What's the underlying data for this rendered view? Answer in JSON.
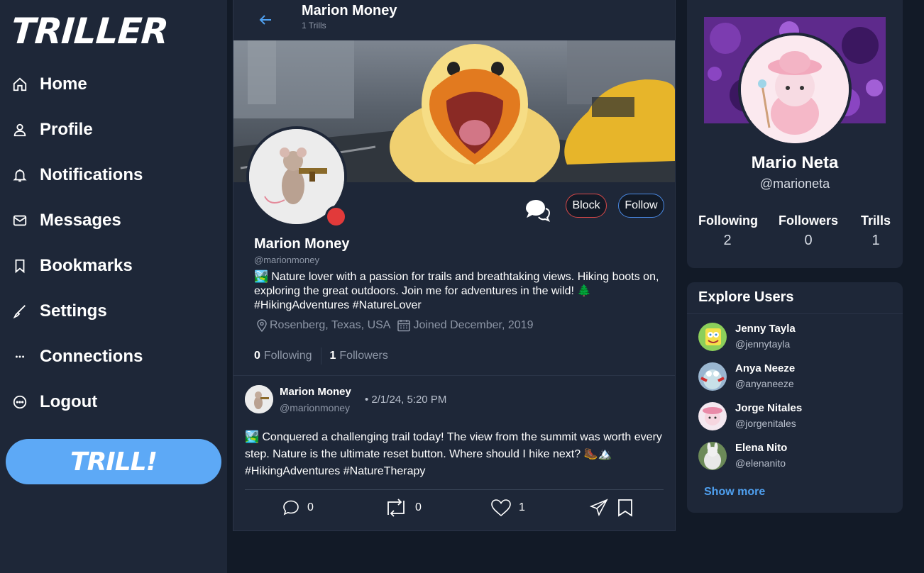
{
  "app": {
    "logo": "TRILLER",
    "compose_label": "TRILL!"
  },
  "sidebar": {
    "items": [
      {
        "label": "Home",
        "icon": "home-icon"
      },
      {
        "label": "Profile",
        "icon": "user-icon"
      },
      {
        "label": "Notifications",
        "icon": "bell-icon"
      },
      {
        "label": "Messages",
        "icon": "mail-icon"
      },
      {
        "label": "Bookmarks",
        "icon": "bookmark-icon"
      },
      {
        "label": "Settings",
        "icon": "brush-icon"
      },
      {
        "label": "Connections",
        "icon": "ellipsis-icon"
      },
      {
        "label": "Logout",
        "icon": "logout-icon"
      }
    ]
  },
  "header": {
    "title": "Marion Money",
    "subtitle": "1 Trills"
  },
  "profile": {
    "name": "Marion Money",
    "handle": "@marionmoney",
    "bio": "🏞️ Nature lover with a passion for trails and breathtaking views. Hiking boots on, exploring the great outdoors. Join me for adventures in the wild! 🌲 #HikingAdventures #NatureLover",
    "location": "Rosenberg, Texas, USA",
    "joined": "Joined December, 2019",
    "following_count": "0",
    "following_label": "Following",
    "followers_count": "1",
    "followers_label": "Followers",
    "block_label": "Block",
    "follow_label": "Follow",
    "status_color": "#e23a3a"
  },
  "post": {
    "name": "Marion Money",
    "handle": "@marionmoney",
    "time": "• 2/1/24, 5:20 PM",
    "text": "🏞️ Conquered a challenging trail today! The view from the summit was worth every step. Nature is the ultimate reset button. Where should I hike next? 🥾🏔️ #HikingAdventures #NatureTherapy",
    "replies": "0",
    "retrills": "0",
    "likes": "1"
  },
  "current_user": {
    "name": "Mario Neta",
    "handle": "@marioneta",
    "stats": [
      {
        "label": "Following",
        "value": "2"
      },
      {
        "label": "Followers",
        "value": "0"
      },
      {
        "label": "Trills",
        "value": "1"
      }
    ]
  },
  "explore": {
    "title": "Explore Users",
    "users": [
      {
        "name": "Jenny Tayla",
        "handle": "@jennytayla"
      },
      {
        "name": "Anya Neeze",
        "handle": "@anyaneeze"
      },
      {
        "name": "Jorge Nitales",
        "handle": "@jorgenitales"
      },
      {
        "name": "Elena Nito",
        "handle": "@elenanito"
      }
    ],
    "show_more": "Show more"
  },
  "colors": {
    "accent": "#5da9f6",
    "link": "#4fa0f0",
    "block_border": "#d94848",
    "follow_border": "#4a8ae6"
  }
}
